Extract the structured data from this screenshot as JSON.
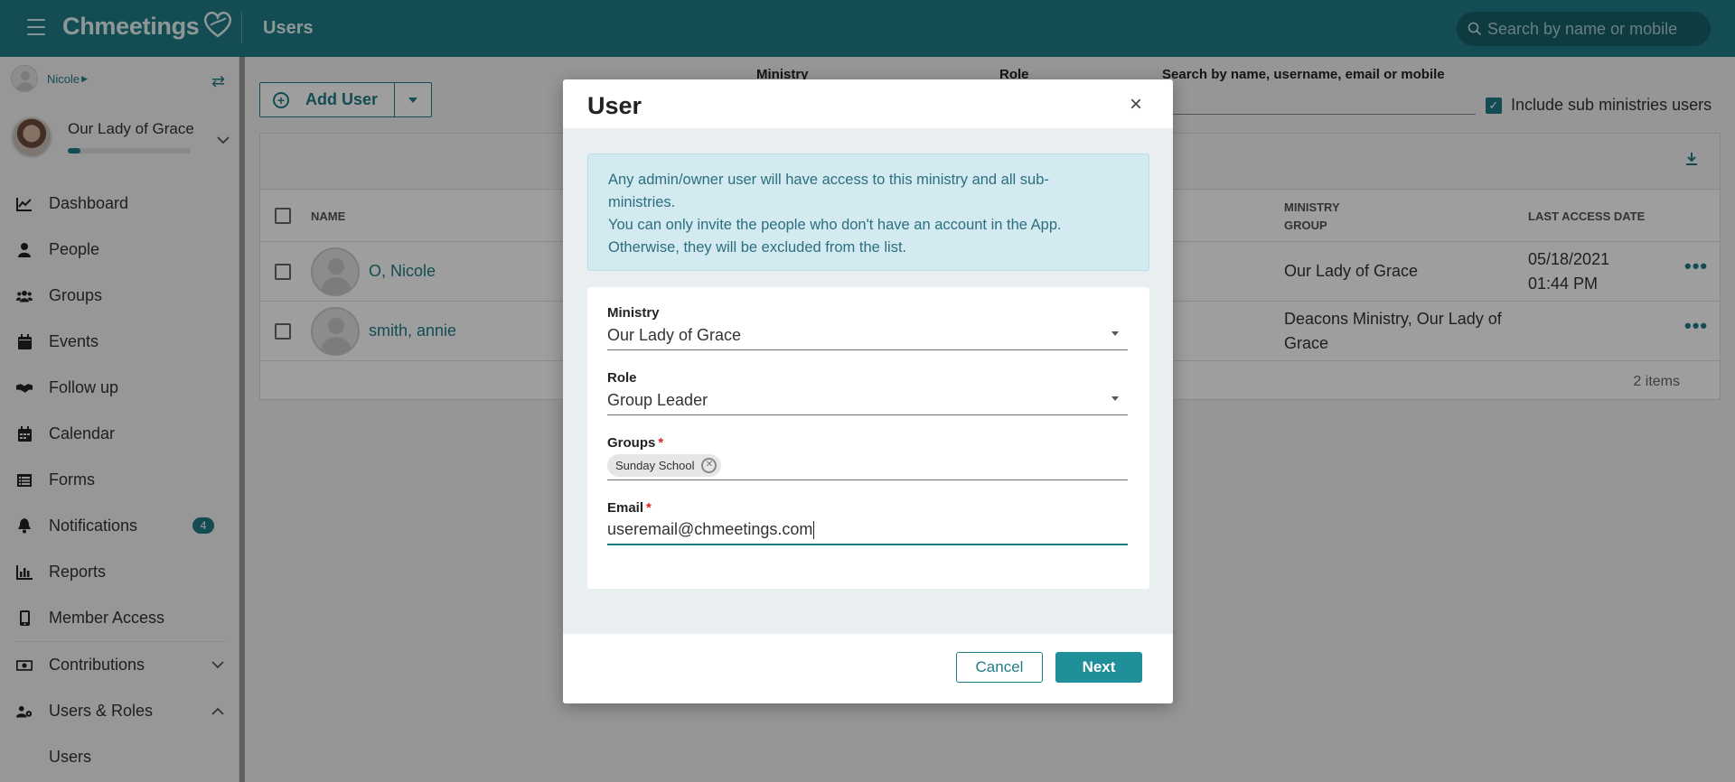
{
  "topbar": {
    "app_name": "Chmeetings",
    "page_title": "Users",
    "search_placeholder": "Search by name or mobile"
  },
  "sidebar": {
    "user_name": "Nicole",
    "church_name": "Our Lady of Grace",
    "church_progress": 0.1,
    "items": [
      {
        "label": "Dashboard",
        "icon": "chart-line-icon"
      },
      {
        "label": "People",
        "icon": "person-icon"
      },
      {
        "label": "Groups",
        "icon": "users-icon"
      },
      {
        "label": "Events",
        "icon": "calendar-icon"
      },
      {
        "label": "Follow up",
        "icon": "handshake-icon"
      },
      {
        "label": "Calendar",
        "icon": "calendar-grid-icon"
      },
      {
        "label": "Forms",
        "icon": "list-icon"
      },
      {
        "label": "Notifications",
        "icon": "bell-icon",
        "badge": "4"
      },
      {
        "label": "Reports",
        "icon": "bar-chart-icon"
      },
      {
        "label": "Member Access",
        "icon": "mobile-icon"
      },
      {
        "label": "Contributions",
        "icon": "money-icon"
      },
      {
        "label": "Users & Roles",
        "icon": "users-cog-icon"
      }
    ],
    "sub_items": [
      "Users"
    ]
  },
  "main": {
    "add_user_label": "Add User",
    "filters": {
      "ministry_label": "Ministry",
      "role_label": "Role",
      "search_label": "Search by name, username, email or mobile",
      "include_sub_label": "Include sub ministries users"
    },
    "table": {
      "headers": [
        "NAME",
        "MINISTRY",
        "GROUP",
        "LAST ACCESS DATE"
      ],
      "rows": [
        {
          "name": "O, Nicole",
          "ministry_group": "Our Lady of Grace",
          "last_access_line1": "05/18/2021",
          "last_access_line2": "01:44 PM"
        },
        {
          "name": "smith, annie",
          "ministry_group_line1": "Deacons Ministry, Our Lady of",
          "ministry_group_line2": "Grace",
          "last_access_line1": "",
          "last_access_line2": ""
        }
      ],
      "items_count": "2 items"
    }
  },
  "modal": {
    "title": "User",
    "close_symbol": "×",
    "alert_lines": [
      "Any admin/owner user will have access to this ministry and all sub-",
      "ministries.",
      "You can only invite the people who don't have an account in the App.",
      "Otherwise, they will be excluded from the list."
    ],
    "ministry": {
      "label": "Ministry",
      "value": "Our Lady of Grace"
    },
    "role": {
      "label": "Role",
      "value": "Group Leader"
    },
    "groups": {
      "label": "Groups",
      "required": "*",
      "chips": [
        "Sunday School"
      ]
    },
    "email": {
      "label": "Email",
      "required": "*",
      "value": "useremail@chmeetings.com"
    },
    "cancel_label": "Cancel",
    "next_label": "Next"
  }
}
